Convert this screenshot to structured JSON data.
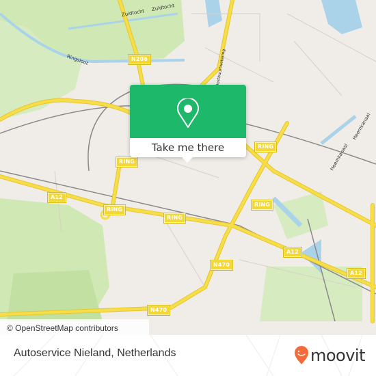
{
  "map": {
    "road_labels": [
      {
        "id": "n206",
        "text": "N206"
      },
      {
        "id": "ring-1",
        "text": "RING"
      },
      {
        "id": "ring-2",
        "text": "RING"
      },
      {
        "id": "ring-3",
        "text": "RING"
      },
      {
        "id": "ring-4",
        "text": "RING"
      },
      {
        "id": "ring-5",
        "text": "RING"
      },
      {
        "id": "a12-1",
        "text": "A12"
      },
      {
        "id": "a12-2",
        "text": "A12"
      },
      {
        "id": "a12-3",
        "text": "A12"
      },
      {
        "id": "n470-1",
        "text": "N470"
      },
      {
        "id": "n470-2",
        "text": "N470"
      }
    ],
    "water_labels": [
      {
        "id": "zuidtocht-1",
        "text": "Zuidtocht"
      },
      {
        "id": "zuidtocht-2",
        "text": "Zuidtocht"
      },
      {
        "id": "ringsloot",
        "text": "Ringsloot"
      },
      {
        "id": "heemkanaal-1",
        "text": "Heemkanaal"
      },
      {
        "id": "heemkanaal-2",
        "text": "Heemkanaal"
      },
      {
        "id": "oostweg",
        "text": "Oostbuurtwetering"
      }
    ],
    "attribution": "© OpenStreetMap contributors",
    "colors": {
      "land": "#f0ece8",
      "green": "#cfe8b4",
      "water": "#aad3ea",
      "road_major": "#f6dd4a",
      "rail": "#8a8a8a"
    }
  },
  "popup": {
    "icon": "map-pin-icon",
    "button_label": "Take me there",
    "color": "#1db86a"
  },
  "footer": {
    "place_title": "Autoservice Nieland, Netherlands",
    "brand_name": "moovit",
    "brand_color": "#f26b3a"
  }
}
